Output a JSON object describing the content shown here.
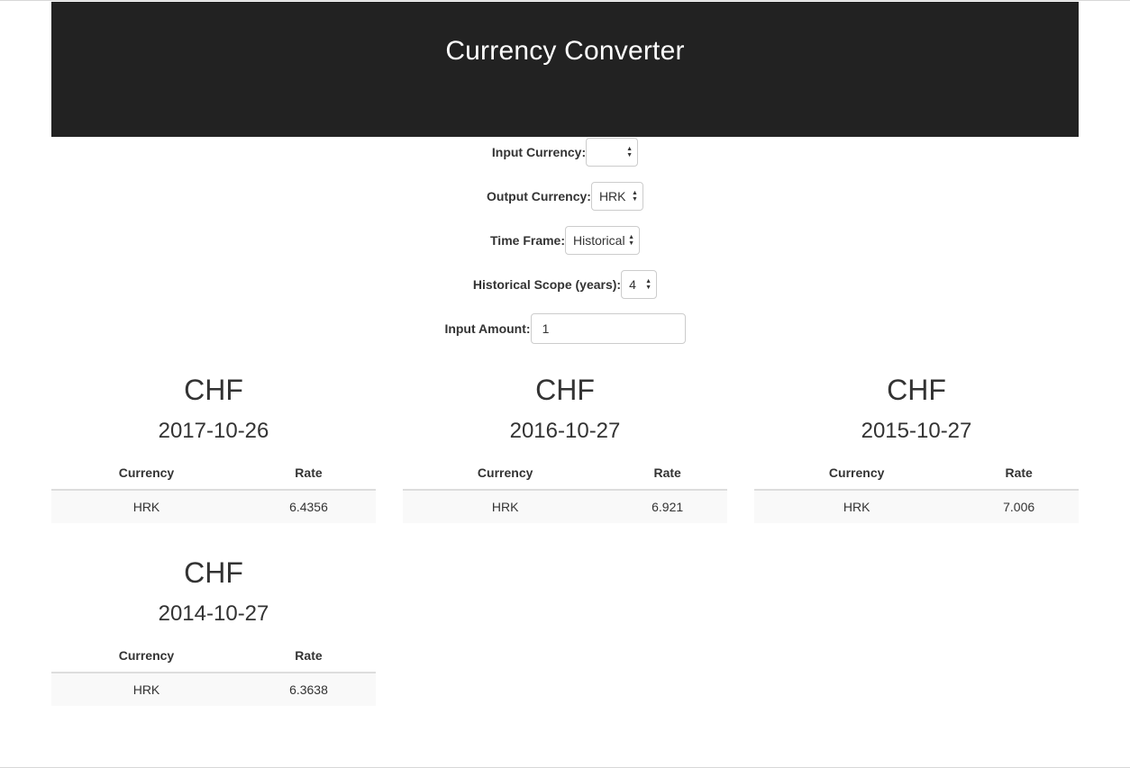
{
  "header": {
    "title": "Currency Converter"
  },
  "form": {
    "input_currency": {
      "label": "Input Currency:",
      "value": ""
    },
    "output_currency": {
      "label": "Output Currency:",
      "value": "HRK"
    },
    "time_frame": {
      "label": "Time Frame:",
      "value": "Historical"
    },
    "historical_scope": {
      "label": "Historical Scope (years):",
      "value": "4"
    },
    "input_amount": {
      "label": "Input Amount:",
      "value": "1"
    }
  },
  "results": [
    {
      "currency": "CHF",
      "date": "2017-10-26",
      "columns": [
        "Currency",
        "Rate"
      ],
      "rows": [
        [
          "HRK",
          "6.4356"
        ]
      ]
    },
    {
      "currency": "CHF",
      "date": "2016-10-27",
      "columns": [
        "Currency",
        "Rate"
      ],
      "rows": [
        [
          "HRK",
          "6.921"
        ]
      ]
    },
    {
      "currency": "CHF",
      "date": "2015-10-27",
      "columns": [
        "Currency",
        "Rate"
      ],
      "rows": [
        [
          "HRK",
          "7.006"
        ]
      ]
    },
    {
      "currency": "CHF",
      "date": "2014-10-27",
      "columns": [
        "Currency",
        "Rate"
      ],
      "rows": [
        [
          "HRK",
          "6.3638"
        ]
      ]
    }
  ],
  "colors": {
    "header_bg": "#222222",
    "header_text": "#ffffff",
    "row_bg": "#f9f9f9"
  }
}
